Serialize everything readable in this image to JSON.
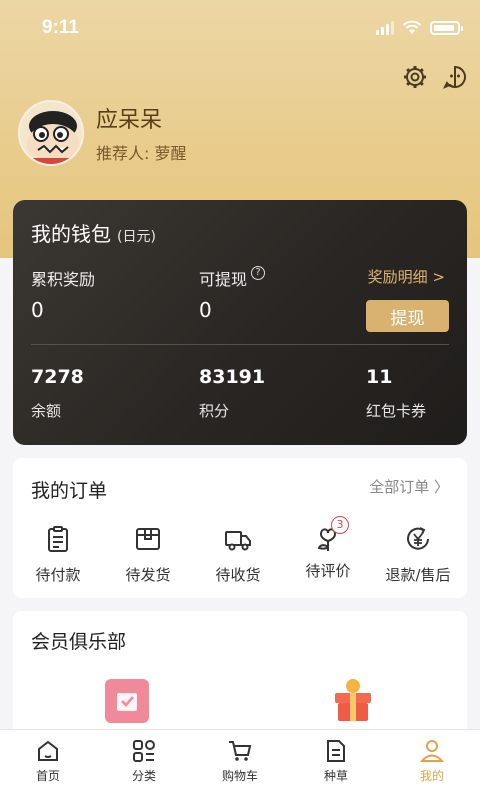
{
  "status_bar": {
    "time": "9:11"
  },
  "profile": {
    "name": "应呆呆",
    "referrer": "推荐人: 萝醒"
  },
  "wallet": {
    "title": "我的钱包",
    "unit": "(日元)",
    "accumulated_label": "累积奖励",
    "accumulated_value": "0",
    "withdrawable_label": "可提现",
    "withdrawable_value": "0",
    "detail_link": "奖励明细 >",
    "withdraw_button": "提现",
    "balance_value": "7278",
    "balance_label": "余额",
    "points_value": "83191",
    "points_label": "积分",
    "coupons_value": "11",
    "coupons_label": "红包卡券"
  },
  "orders": {
    "title": "我的订单",
    "all_link": "全部订单 〉",
    "items": [
      {
        "label": "待付款"
      },
      {
        "label": "待发货"
      },
      {
        "label": "待收货"
      },
      {
        "label": "待评价",
        "badge": "3"
      },
      {
        "label": "退款/售后"
      }
    ]
  },
  "club": {
    "title": "会员俱乐部"
  },
  "tabbar": {
    "items": [
      {
        "label": "首页"
      },
      {
        "label": "分类"
      },
      {
        "label": "购物车"
      },
      {
        "label": "种草"
      },
      {
        "label": "我的"
      }
    ]
  },
  "colors": {
    "accent": "#e0a24a",
    "gold": "#d8b26e",
    "wallet_bg": "#2a2623",
    "badge": "#e6414b"
  }
}
